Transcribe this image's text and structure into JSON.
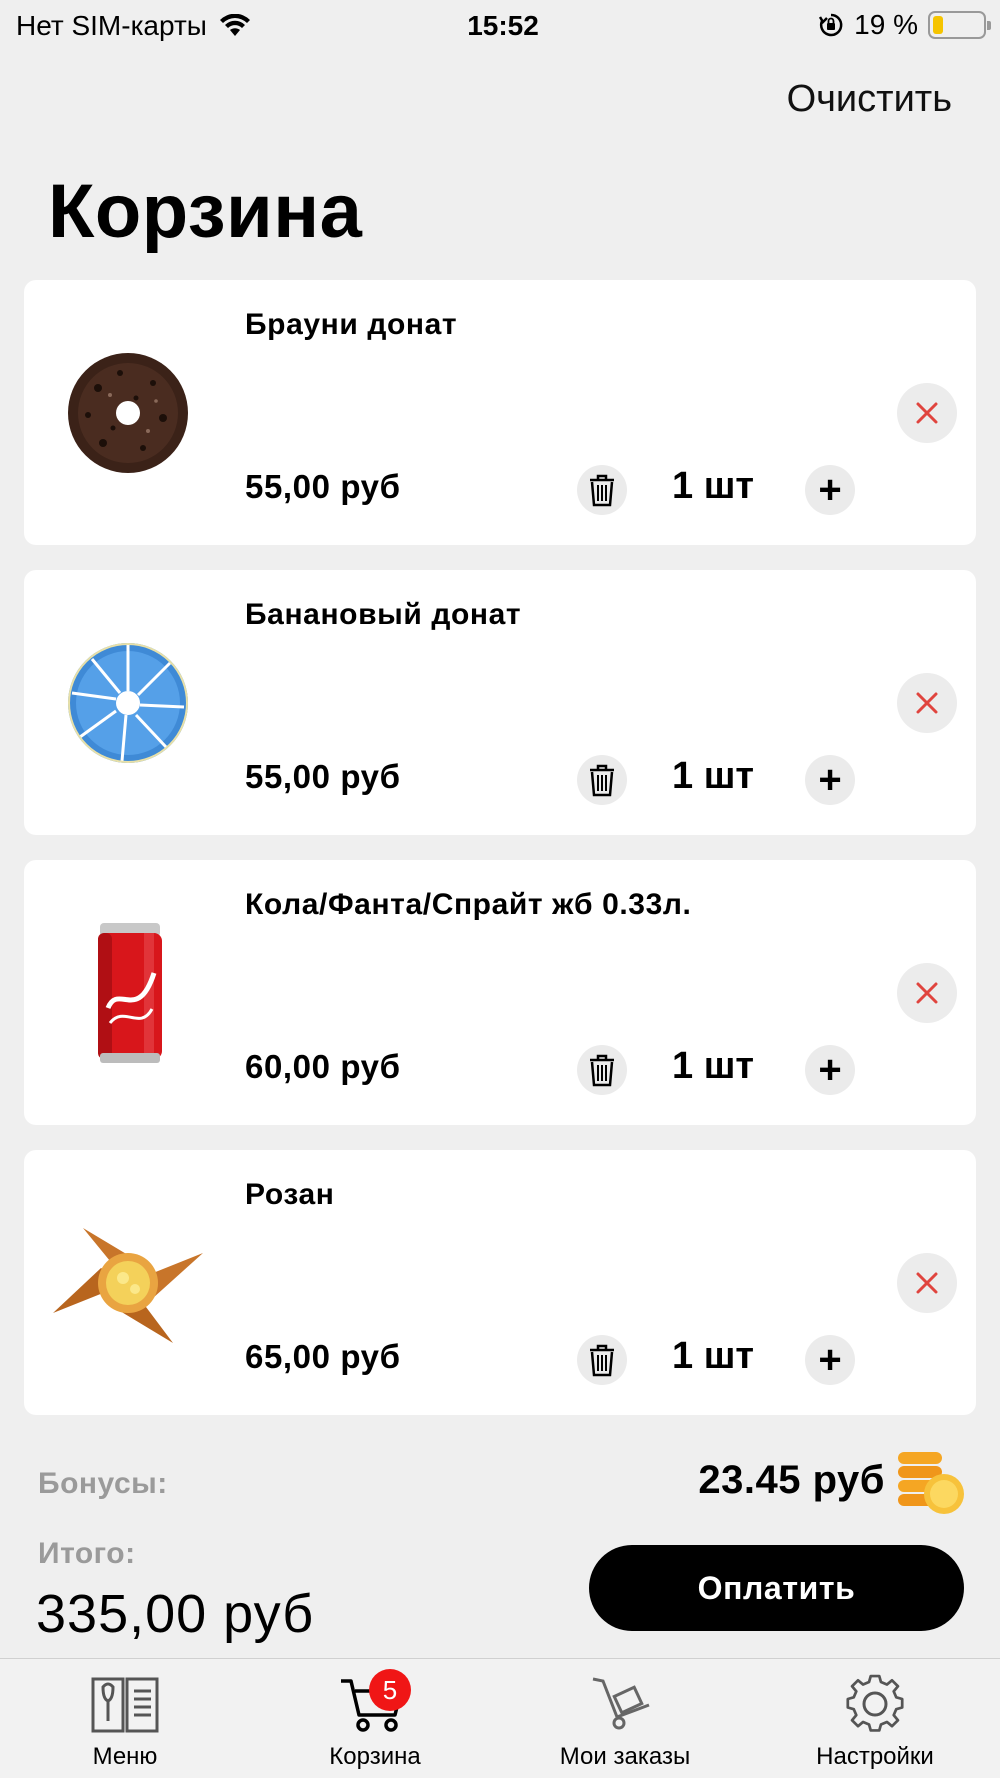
{
  "status_bar": {
    "carrier": "Нет SIM-карты",
    "time": "15:52",
    "battery": "19 %",
    "battery_level": 0.19
  },
  "header": {
    "clear_label": "Очистить",
    "title": "Корзина"
  },
  "cart": {
    "items": [
      {
        "name": "Брауни донат",
        "price": "55,00 руб",
        "qty": "1 шт"
      },
      {
        "name": "Банановый донат",
        "price": "55,00 руб",
        "qty": "1 шт"
      },
      {
        "name": "Кола/Фанта/Спрайт жб 0.33л.",
        "price": "60,00 руб",
        "qty": "1 шт"
      },
      {
        "name": "Розан",
        "price": "65,00 руб",
        "qty": "1 шт"
      }
    ]
  },
  "summary": {
    "bonus_label": "Бонусы:",
    "bonus_value": "23.45 руб",
    "total_label": "Итого:",
    "total_value": "335,00 руб",
    "pay_label": "Оплатить"
  },
  "tabbar": {
    "tabs": [
      {
        "label": "Меню",
        "icon": "menu-book-icon"
      },
      {
        "label": "Корзина",
        "icon": "cart-icon",
        "badge": "5"
      },
      {
        "label": "Мои заказы",
        "icon": "hand-truck-icon"
      },
      {
        "label": "Настройки",
        "icon": "gear-icon"
      }
    ]
  },
  "colors": {
    "background": "#efefef",
    "card": "#ffffff",
    "remove_icon": "#e0443e",
    "badge": "#f01616",
    "pay_button": "#000000",
    "muted_label": "#9a9a9a",
    "coins": "#f5a623"
  }
}
